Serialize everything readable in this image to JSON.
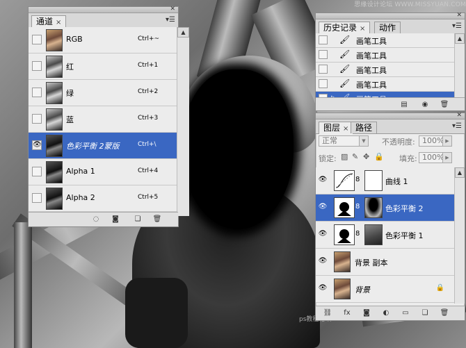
{
  "watermark": {
    "top": "思缘设计论坛 WWW.MISSYUAN.COM",
    "bottom": "ps教程论坛 bbs.16xx8.com"
  },
  "channels_panel": {
    "tab_label": "通道",
    "rows": [
      {
        "name": "RGB",
        "shortcut": "Ctrl+~",
        "thumb": "color",
        "visible": false,
        "selected": false
      },
      {
        "name": "红",
        "shortcut": "Ctrl+1",
        "thumb": "gray",
        "visible": false,
        "selected": false
      },
      {
        "name": "绿",
        "shortcut": "Ctrl+2",
        "thumb": "gray",
        "visible": false,
        "selected": false
      },
      {
        "name": "蓝",
        "shortcut": "Ctrl+3",
        "thumb": "gray",
        "visible": false,
        "selected": false
      },
      {
        "name": "色彩平衡 2蒙版",
        "shortcut": "Ctrl+\\",
        "thumb": "dark",
        "visible": true,
        "selected": true
      },
      {
        "name": "Alpha 1",
        "shortcut": "Ctrl+4",
        "thumb": "dark",
        "visible": false,
        "selected": false
      },
      {
        "name": "Alpha 2",
        "shortcut": "Ctrl+5",
        "thumb": "dark",
        "visible": false,
        "selected": false
      }
    ],
    "footer_icons": [
      "dotted-circle-icon",
      "save-selection-icon",
      "new-channel-icon",
      "trash-icon"
    ]
  },
  "history_panel": {
    "tabs": [
      "历史记录",
      "动作"
    ],
    "rows": [
      {
        "name": "画笔工具",
        "selected": false
      },
      {
        "name": "画笔工具",
        "selected": false
      },
      {
        "name": "画笔工具",
        "selected": false
      },
      {
        "name": "画笔工具",
        "selected": false
      },
      {
        "name": "画笔工具",
        "selected": true
      }
    ]
  },
  "layers_panel": {
    "tabs": [
      "图层",
      "路径"
    ],
    "blend_mode": "正常",
    "opacity_label": "不透明度:",
    "opacity_value": "100%",
    "lock_label": "锁定:",
    "fill_label": "填充:",
    "fill_value": "100%",
    "layers": [
      {
        "name": "曲线 1",
        "kind": "curves",
        "selected": false
      },
      {
        "name": "色彩平衡 2",
        "kind": "balance",
        "selected": true
      },
      {
        "name": "色彩平衡 1",
        "kind": "balance",
        "selected": false
      },
      {
        "name": "背景 副本",
        "kind": "image",
        "selected": false
      },
      {
        "name": "背景",
        "kind": "background",
        "selected": false
      }
    ]
  },
  "colors": {
    "selection": "#3a67c2",
    "panel": "#ececec"
  }
}
